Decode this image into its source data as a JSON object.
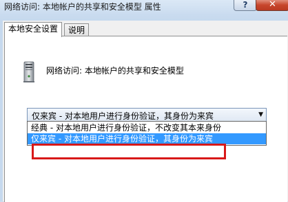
{
  "window": {
    "title": "网络访问: 本地帐户的共享和安全模型 属性",
    "help_label": "?",
    "close_label": "✕"
  },
  "tabs": [
    {
      "label": "本地安全设置",
      "active": true
    },
    {
      "label": "说明",
      "active": false
    }
  ],
  "policy": {
    "icon": "computer-tower-icon",
    "name": "网络访问: 本地帐户的共享和安全模型"
  },
  "combo": {
    "selected": "仅来宾 - 对本地用户进行身份验证，其身份为来宾",
    "options": [
      "经典 - 对本地用户进行身份验证，不改变其本来身份",
      "仅来宾 - 对本地用户进行身份验证，其身份为来宾"
    ],
    "highlighted_index": 1
  },
  "colors": {
    "selection": "#3399ff",
    "annotation_box": "#d81818",
    "close_button": "#c7462c"
  }
}
